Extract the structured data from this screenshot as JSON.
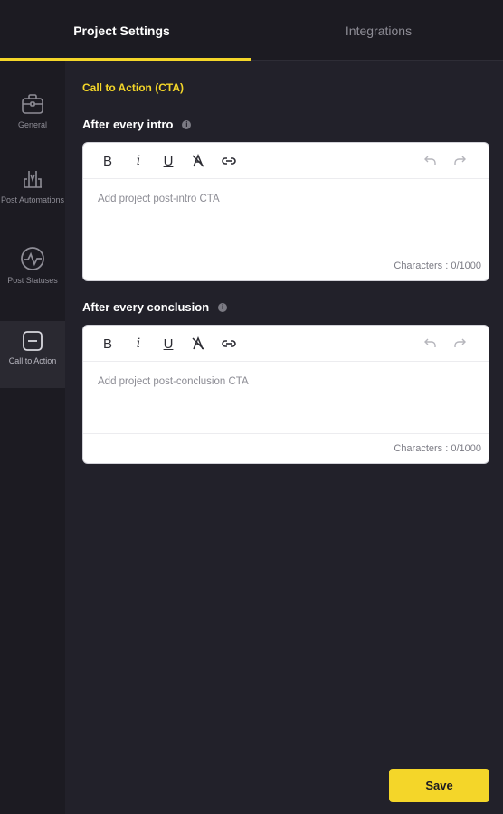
{
  "tabs": {
    "project_settings": "Project Settings",
    "integrations": "Integrations"
  },
  "sidebar": {
    "items": [
      {
        "label": "General",
        "icon": "briefcase-icon",
        "active": false
      },
      {
        "label": "Post Automations",
        "icon": "automation-icon",
        "active": false
      },
      {
        "label": "Post Statuses",
        "icon": "activity-icon",
        "active": false
      },
      {
        "label": "Call to Action",
        "icon": "cta-icon",
        "active": true
      }
    ]
  },
  "main": {
    "section_title": "Call to Action (CTA)",
    "intro": {
      "label": "After every intro",
      "placeholder": "Add project post-intro CTA",
      "char_count": "Characters : 0/1000"
    },
    "conclusion": {
      "label": "After every conclusion",
      "placeholder": "Add project post-conclusion CTA",
      "char_count": "Characters : 0/1000"
    },
    "toolbar": {
      "bold": "B",
      "italic": "i",
      "underline": "U",
      "info_glyph": "i"
    },
    "save_label": "Save"
  },
  "colors": {
    "accent": "#f4d629",
    "background": "#22212a",
    "sidebar": "#1c1b22"
  }
}
